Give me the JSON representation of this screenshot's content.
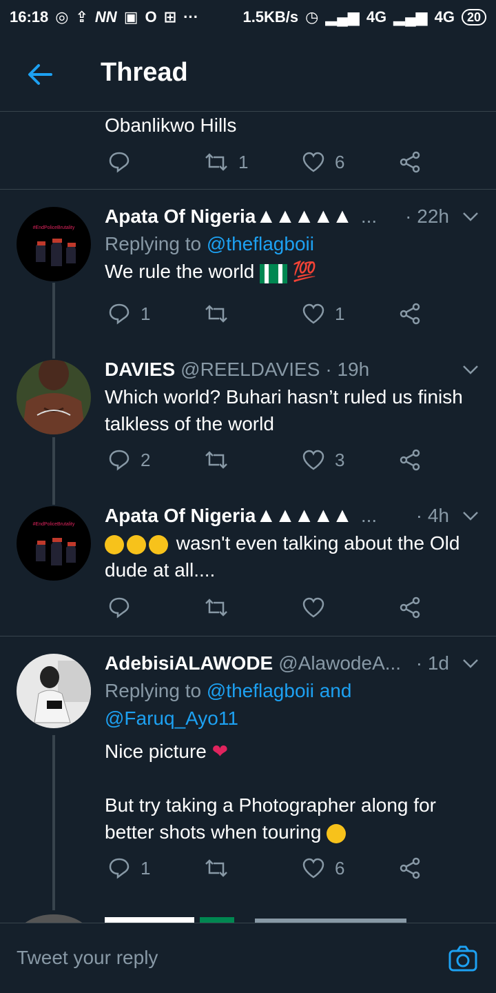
{
  "status_bar": {
    "time": "16:18",
    "speed": "1.5KB/s",
    "network1": "4G",
    "network2": "4G",
    "battery": "20"
  },
  "header": {
    "title": "Thread"
  },
  "top_tweet": {
    "text": "Obanlikwo Hills",
    "retweets": "1",
    "likes": "6"
  },
  "tweets": [
    {
      "name": "Apata Of Nigeria",
      "triangles": "▲▲▲▲▲",
      "ellipsis": "...",
      "time": "· 22h",
      "reply_prefix": "Replying to",
      "reply_mention": "@theflagboii",
      "text": "We rule the world",
      "emoji_100": "💯",
      "replies": "1",
      "likes": "1"
    },
    {
      "name": "DAVIES",
      "handle": "@REELDAVIES",
      "time": "· 19h",
      "text": "Which world? Buhari hasn’t ruled us finish talkless of the world",
      "replies": "2",
      "likes": "3"
    },
    {
      "name": "Apata Of Nigeria",
      "triangles": "▲▲▲▲▲",
      "ellipsis": "...",
      "time": "· 4h",
      "text": "wasn't even talking about the Old dude at all...."
    },
    {
      "name": "AdebisiALAWODE",
      "handle": "@AlawodeA...",
      "time": "· 1d",
      "reply_prefix": "Replying to",
      "reply_mention1": "@theflagboii and",
      "reply_mention2": "@Faruq_Ayo11",
      "text1": "Nice picture",
      "text2": "But try taking a Photographer along for better shots when touring",
      "replies": "1",
      "likes": "6"
    }
  ],
  "avatar_caption": "#EndPoliceBrutality",
  "reply_box": {
    "placeholder": "Tweet your reply"
  },
  "colors": {
    "background": "#15202b",
    "accent": "#1da1f2",
    "muted": "#8899a6",
    "divider": "#38444d"
  }
}
